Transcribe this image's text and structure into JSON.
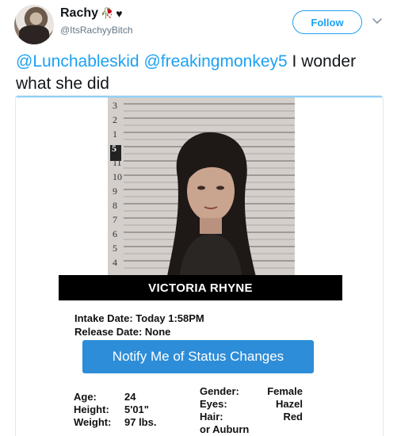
{
  "tweet": {
    "display_name": "Rachy",
    "name_emojis": [
      "rose-icon",
      "black-heart-icon"
    ],
    "handle": "@ItsRachyyBitch",
    "follow_label": "Follow",
    "mention_1": "@Lunchableskid",
    "mention_2": "@freakingmonkey5",
    "text_rest": " I wonder what she did"
  },
  "card": {
    "height_chart_numbers": [
      "3",
      "2",
      "1",
      "5",
      "11",
      "10",
      "9",
      "8",
      "7",
      "6",
      "5",
      "4"
    ],
    "name": "VICTORIA RHYNE",
    "intake": "Intake Date: Today 1:58PM",
    "release": "Release Date: None",
    "notify_label": "Notify Me of Status Changes",
    "age_label": "Age:",
    "age_value": "24",
    "height_label": "Height:",
    "height_value": "5'01\"",
    "weight_label": "Weight:",
    "weight_value": "97 lbs.",
    "gender_label": "Gender:",
    "gender_value": "Female",
    "eyes_label": "Eyes:",
    "eyes_value": "Hazel",
    "hair_label": "Hair:",
    "hair_value": "Red",
    "hair_value_cont": "or Auburn"
  },
  "colors": {
    "twitter_blue": "#1da1f2",
    "notify_button": "#2d8dd8",
    "name_bar": "#000000"
  }
}
